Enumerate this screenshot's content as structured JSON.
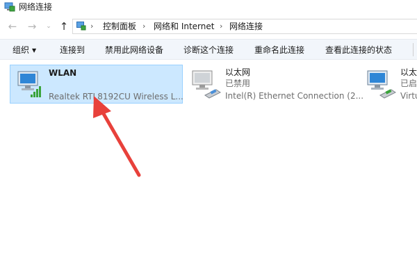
{
  "window": {
    "title": "网络连接"
  },
  "nav": {
    "back": "←",
    "forward": "→",
    "recent": "⌄",
    "up": "↑"
  },
  "address": {
    "crumbs": [
      "控制面板",
      "网络和 Internet",
      "网络连接"
    ],
    "separator": "›"
  },
  "commands": {
    "organize": "组织",
    "connect": "连接到",
    "disable": "禁用此网络设备",
    "diagnose": "诊断这个连接",
    "rename": "重命名此连接",
    "status": "查看此连接的状态"
  },
  "connections": [
    {
      "name": "WLAN",
      "status": "",
      "device": "Realtek RTL8192CU Wireless L...",
      "icon": "wifi-adapter-icon"
    },
    {
      "name": "以太网",
      "status": "已禁用",
      "device": "Intel(R) Ethernet Connection (2...",
      "icon": "ethernet-adapter-icon"
    },
    {
      "name": "以太",
      "status": "已启",
      "device": "Virtu",
      "icon": "ethernet-adapter-icon"
    }
  ],
  "colors": {
    "selection": "#cce8ff",
    "selection_border": "#99d1ff",
    "annotation_arrow": "#e8413b"
  }
}
